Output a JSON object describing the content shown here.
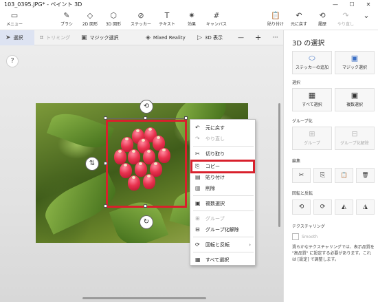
{
  "window": {
    "title": "103_0395.JPG* - ペイント 3D",
    "controls": [
      "—",
      "☐",
      "✕"
    ]
  },
  "ribbon": {
    "menu": {
      "label": "メニュー",
      "icon": "folder-icon"
    },
    "tools": [
      {
        "label": "ブラシ",
        "icon": "brush-icon"
      },
      {
        "label": "2D 図形",
        "icon": "2d-shape-icon"
      },
      {
        "label": "3D 図形",
        "icon": "3d-shape-icon"
      },
      {
        "label": "ステッカー",
        "icon": "sticker-icon"
      },
      {
        "label": "テキスト",
        "icon": "text-icon"
      },
      {
        "label": "効果",
        "icon": "effects-icon"
      },
      {
        "label": "キャンバス",
        "icon": "canvas-icon"
      }
    ],
    "right_tools": [
      {
        "label": "貼り付け",
        "icon": "paste-icon"
      },
      {
        "label": "元に戻す",
        "icon": "undo-icon"
      },
      {
        "label": "履歴",
        "icon": "history-icon"
      },
      {
        "label": "やり直し",
        "icon": "redo-icon"
      }
    ]
  },
  "toolbar": {
    "select": "選択",
    "crop": "トリミング",
    "magic_select": "マジック選択",
    "mixed_reality": "Mixed Reality",
    "view3d": "3D 表示",
    "zoom_out": "—",
    "zoom_in": "+",
    "more": "···"
  },
  "help": {
    "label": "?"
  },
  "context_menu": {
    "items": [
      {
        "label": "元に戻す",
        "icon": "undo-icon",
        "enabled": true
      },
      {
        "label": "やり直し",
        "icon": "redo-icon",
        "enabled": false
      },
      {
        "label": "切り取り",
        "icon": "cut-icon",
        "enabled": true
      },
      {
        "label": "コピー",
        "icon": "copy-icon",
        "enabled": true
      },
      {
        "label": "貼り付け",
        "icon": "paste-icon",
        "enabled": true
      },
      {
        "label": "削除",
        "icon": "delete-icon",
        "enabled": true
      },
      {
        "label": "複数選択",
        "icon": "multi-select-icon",
        "enabled": true
      },
      {
        "label": "グループ",
        "icon": "group-icon",
        "enabled": false
      },
      {
        "label": "グループ化解除",
        "icon": "ungroup-icon",
        "enabled": true
      },
      {
        "label": "回転と反転",
        "icon": "rotate-icon",
        "enabled": true
      },
      {
        "label": "すべて選択",
        "icon": "select-all-icon",
        "enabled": true
      }
    ],
    "submenu_arrow": "›"
  },
  "panel": {
    "title": "3D の選択",
    "top_buttons": [
      {
        "label": "ステッカーの追加",
        "icon": "sticker-icon"
      },
      {
        "label": "マジック選択",
        "icon": "magic-select-icon"
      }
    ],
    "select_section": "選択",
    "select_buttons": [
      {
        "label": "すべて選択",
        "icon": "select-all-icon"
      },
      {
        "label": "複数選択",
        "icon": "multi-select-icon"
      }
    ],
    "group_section": "グループ化",
    "group_buttons": [
      {
        "label": "グループ",
        "icon": "group-icon"
      },
      {
        "label": "グループ化解除",
        "icon": "ungroup-icon"
      }
    ],
    "edit_section": "編集",
    "edit_buttons": [
      "✂",
      "⎘",
      "📋",
      "🗑"
    ],
    "rotate_section": "回転と反転",
    "rotate_buttons": [
      "⟲",
      "⟳",
      "◭",
      "◮"
    ],
    "texturing_section": "テクスチャリング",
    "smooth_label": "Smooth",
    "description": "滑らかなテクスチャリングでは、表示品質を \"高品質\" に設定する必要があります。これは [設定] で調整します。"
  },
  "colors": {
    "accent": "#3b6fc4",
    "highlight_red": "#d8202c",
    "panel_bg": "#ffffff",
    "canvas_bg": "#e2e2e2"
  }
}
